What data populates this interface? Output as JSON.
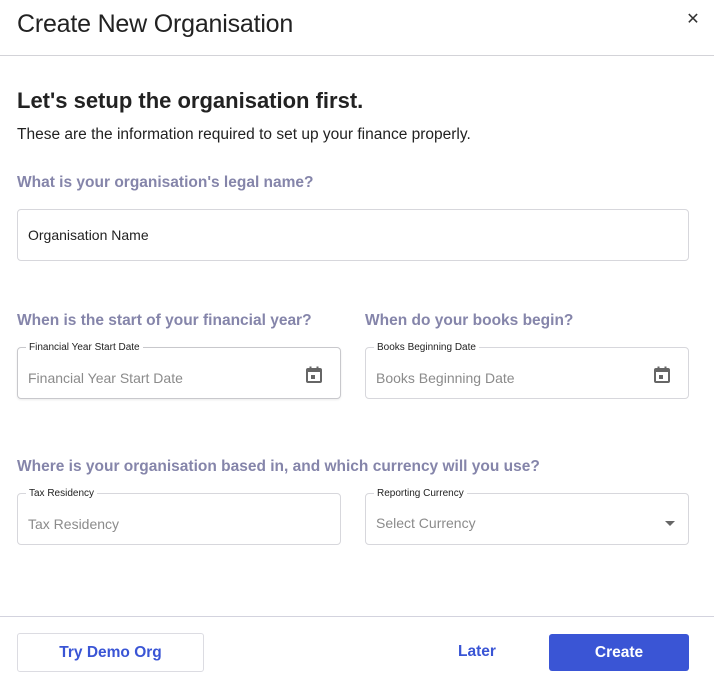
{
  "dialog": {
    "title": "Create New Organisation",
    "close_icon": "close-icon",
    "close_glyph": "✕"
  },
  "intro": {
    "heading": "Let's setup the organisation first.",
    "subtitle": "These are the information required to set up your finance properly."
  },
  "legal_name": {
    "question": "What is your organisation's legal name?",
    "value": "Organisation Name"
  },
  "financial_year": {
    "question": "When is the start of your financial year?",
    "label": "Financial Year Start Date",
    "placeholder": "Financial Year Start Date",
    "icon": "calendar-icon"
  },
  "books_begin": {
    "question": "When do your books begin?",
    "label": "Books Beginning Date",
    "placeholder": "Books Beginning Date",
    "icon": "calendar-icon"
  },
  "location": {
    "question": "Where is your organisation based in, and which currency will you use?",
    "tax_residency": {
      "label": "Tax Residency",
      "placeholder": "Tax Residency"
    },
    "currency": {
      "label": "Reporting Currency",
      "placeholder": "Select Currency",
      "icon": "chevron-down-icon"
    }
  },
  "footer": {
    "demo_label": "Try Demo Org",
    "later_label": "Later",
    "create_label": "Create"
  },
  "colors": {
    "accent": "#3a55d5",
    "question_text": "#8585aa",
    "border": "#d7d7dc"
  }
}
